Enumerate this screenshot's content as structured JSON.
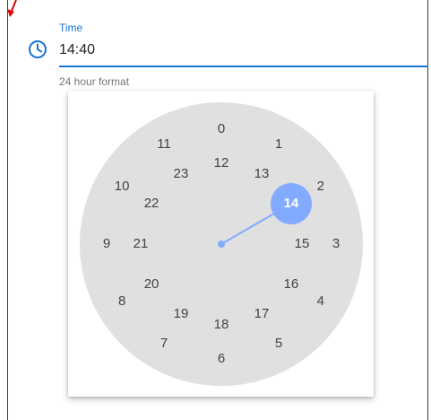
{
  "field": {
    "label": "Time",
    "value": "14:40",
    "helper": "24 hour format"
  },
  "icons": {
    "clock": "clock-icon",
    "annotation": "red-arrow-icon"
  },
  "colors": {
    "accent": "#1976d2",
    "selection": "#82aaff",
    "face": "#e0e0e0",
    "annotation": "#e00000"
  },
  "clock": {
    "selected_hour": "14",
    "outer_hours": [
      "0",
      "1",
      "2",
      "3",
      "4",
      "5",
      "6",
      "7",
      "8",
      "9",
      "10",
      "11"
    ],
    "inner_hours": [
      "12",
      "13",
      "14",
      "15",
      "16",
      "17",
      "18",
      "19",
      "20",
      "21",
      "22",
      "23"
    ]
  }
}
